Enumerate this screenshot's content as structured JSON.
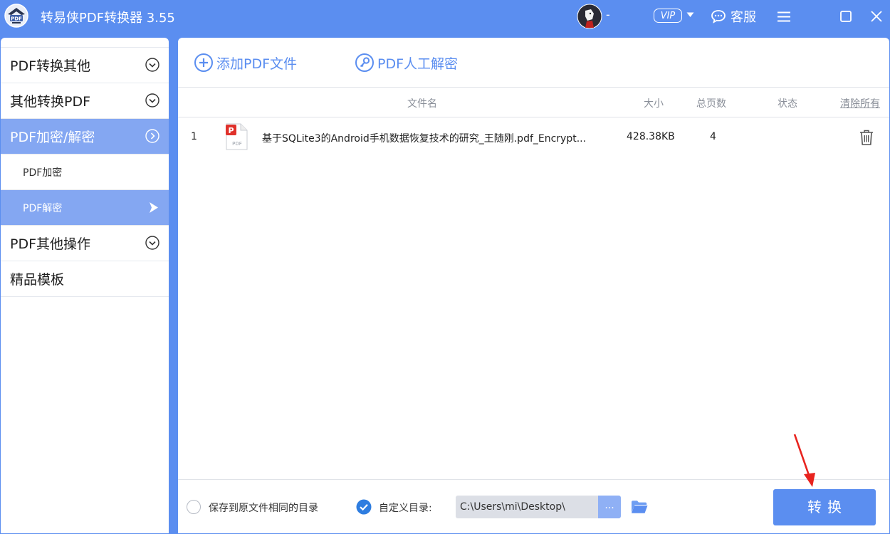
{
  "titlebar": {
    "app_title": "转易侠PDF转换器 3.55",
    "username": "-",
    "vip_label": "VIP",
    "service_label": "客服",
    "icons": [
      "app-logo",
      "user-avatar",
      "chevron-down-icon",
      "chat-icon",
      "menu-icon",
      "maximize-icon",
      "close-icon"
    ]
  },
  "sidebar": {
    "categories": [
      {
        "label": "PDF转换其他",
        "state": "collapsed"
      },
      {
        "label": "其他转换PDF",
        "state": "collapsed"
      },
      {
        "label": "PDF加密/解密",
        "state": "expanded"
      },
      {
        "label": "PDF其他操作",
        "state": "collapsed"
      },
      {
        "label": "精品模板"
      }
    ],
    "sub_items": [
      "PDF加密",
      "PDF解密"
    ],
    "selected": "PDF解密"
  },
  "toolbar": {
    "add_label": "添加PDF文件",
    "unlock_label": "PDF人工解密"
  },
  "table": {
    "headers": {
      "name": "文件名",
      "size": "大小",
      "pages": "总页数",
      "status": "状态",
      "clear": "清除所有"
    },
    "rows": [
      {
        "index": "1",
        "name": "基于SQLite3的Android手机数据恢复技术的研究_王随刚.pdf_Encrypt...",
        "size": "428.38KB",
        "pages": "4",
        "status": ""
      }
    ]
  },
  "bottom": {
    "same_dir_label": "保存到原文件相同的目录",
    "same_dir_checked": false,
    "custom_dir_label": "自定义目录:",
    "custom_dir_checked": true,
    "path_value": "C:\\Users\\mi\\Desktop\\",
    "browse_label": "...",
    "convert_label": "转换"
  },
  "colors": {
    "accent": "#5b8ef0",
    "sidebar_active": "#84a7f2",
    "annotation_arrow": "#e8231e"
  }
}
